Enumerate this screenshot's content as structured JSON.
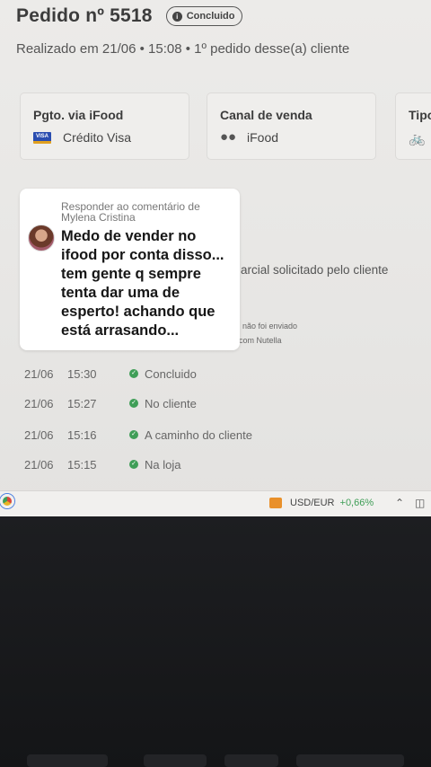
{
  "order": {
    "title": "Pedido nº 5518",
    "status": "Concluido",
    "subtitle": "Realizado em 21/06 • 15:08 • 1º pedido desse(a) cliente"
  },
  "cards": [
    {
      "label": "Pgto. via iFood",
      "value": "Crédito Visa",
      "icon": "visa-card-icon"
    },
    {
      "label": "Canal de venda",
      "value": "iFood",
      "icon": "ifood-icon"
    },
    {
      "label": "Tipo",
      "value": "",
      "icon": "bike-icon"
    }
  ],
  "comment": {
    "reply_header": "Responder ao comentário de Mylena Cristina",
    "text": "Medo de vender no ifood por conta disso... tem gente q sempre tenta dar uma de esperto! achando que está arrasando..."
  },
  "background_texts": {
    "partial": "arcial solicitado pelo cliente",
    "note1": "não foi enviado",
    "note2": "com Nutella"
  },
  "timeline": [
    {
      "date": "21/06",
      "time": "15:30",
      "state": "Concluido"
    },
    {
      "date": "21/06",
      "time": "15:27",
      "state": "No cliente"
    },
    {
      "date": "21/06",
      "time": "15:16",
      "state": "A caminho do cliente"
    },
    {
      "date": "21/06",
      "time": "15:15",
      "state": "Na loja"
    }
  ],
  "taskbar": {
    "ticker_label": "USD/EUR",
    "ticker_change": "+0,66%"
  },
  "colors": {
    "accent_green": "#3f9e57",
    "ticker_orange": "#e9902a"
  }
}
